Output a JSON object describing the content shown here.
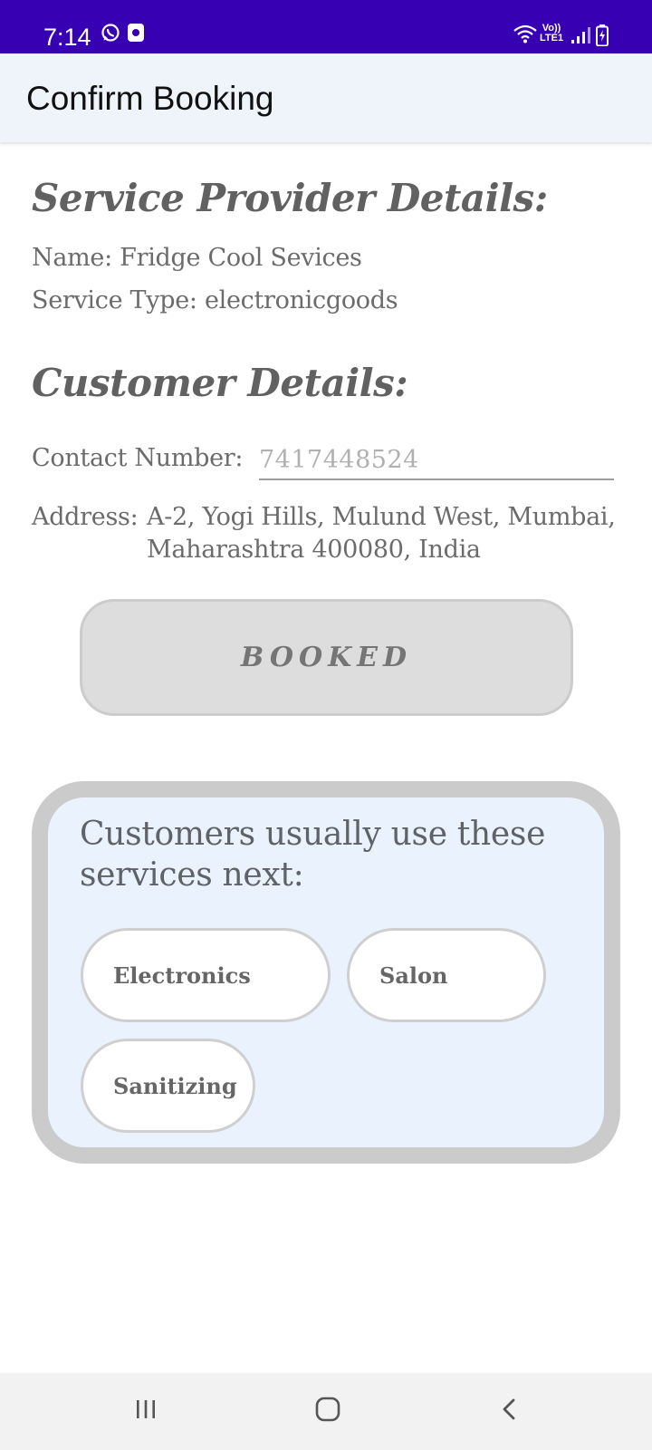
{
  "status_bar": {
    "time": "7:14",
    "volte_top": "Vo))",
    "volte_bottom": "LTE1",
    "icons": [
      "whatsapp-icon",
      "message-icon",
      "wifi-icon",
      "signal-icon",
      "battery-charging-icon"
    ],
    "background": "#3700b3"
  },
  "app_bar": {
    "title": "Confirm Booking"
  },
  "provider": {
    "heading": "Service Provider Details:",
    "name_line": "Name: Fridge Cool Sevices",
    "service_type_line": "Service Type: electronicgoods"
  },
  "customer": {
    "heading": "Customer Details:",
    "contact_label": "Contact Number:",
    "contact_value": "7417448524",
    "address_label": "Address:",
    "address_value": "A-2, Yogi Hills, Mulund West, Mumbai, Maharashtra 400080, India"
  },
  "booked_button": {
    "label": "BOOKED"
  },
  "suggestions": {
    "title": "Customers usually use these services next:",
    "chips": [
      {
        "label": "Electronics"
      },
      {
        "label": "Salon"
      },
      {
        "label": "Sanitizing"
      }
    ]
  },
  "nav_bar": {
    "icons": [
      "recents-icon",
      "home-icon",
      "back-icon"
    ]
  }
}
